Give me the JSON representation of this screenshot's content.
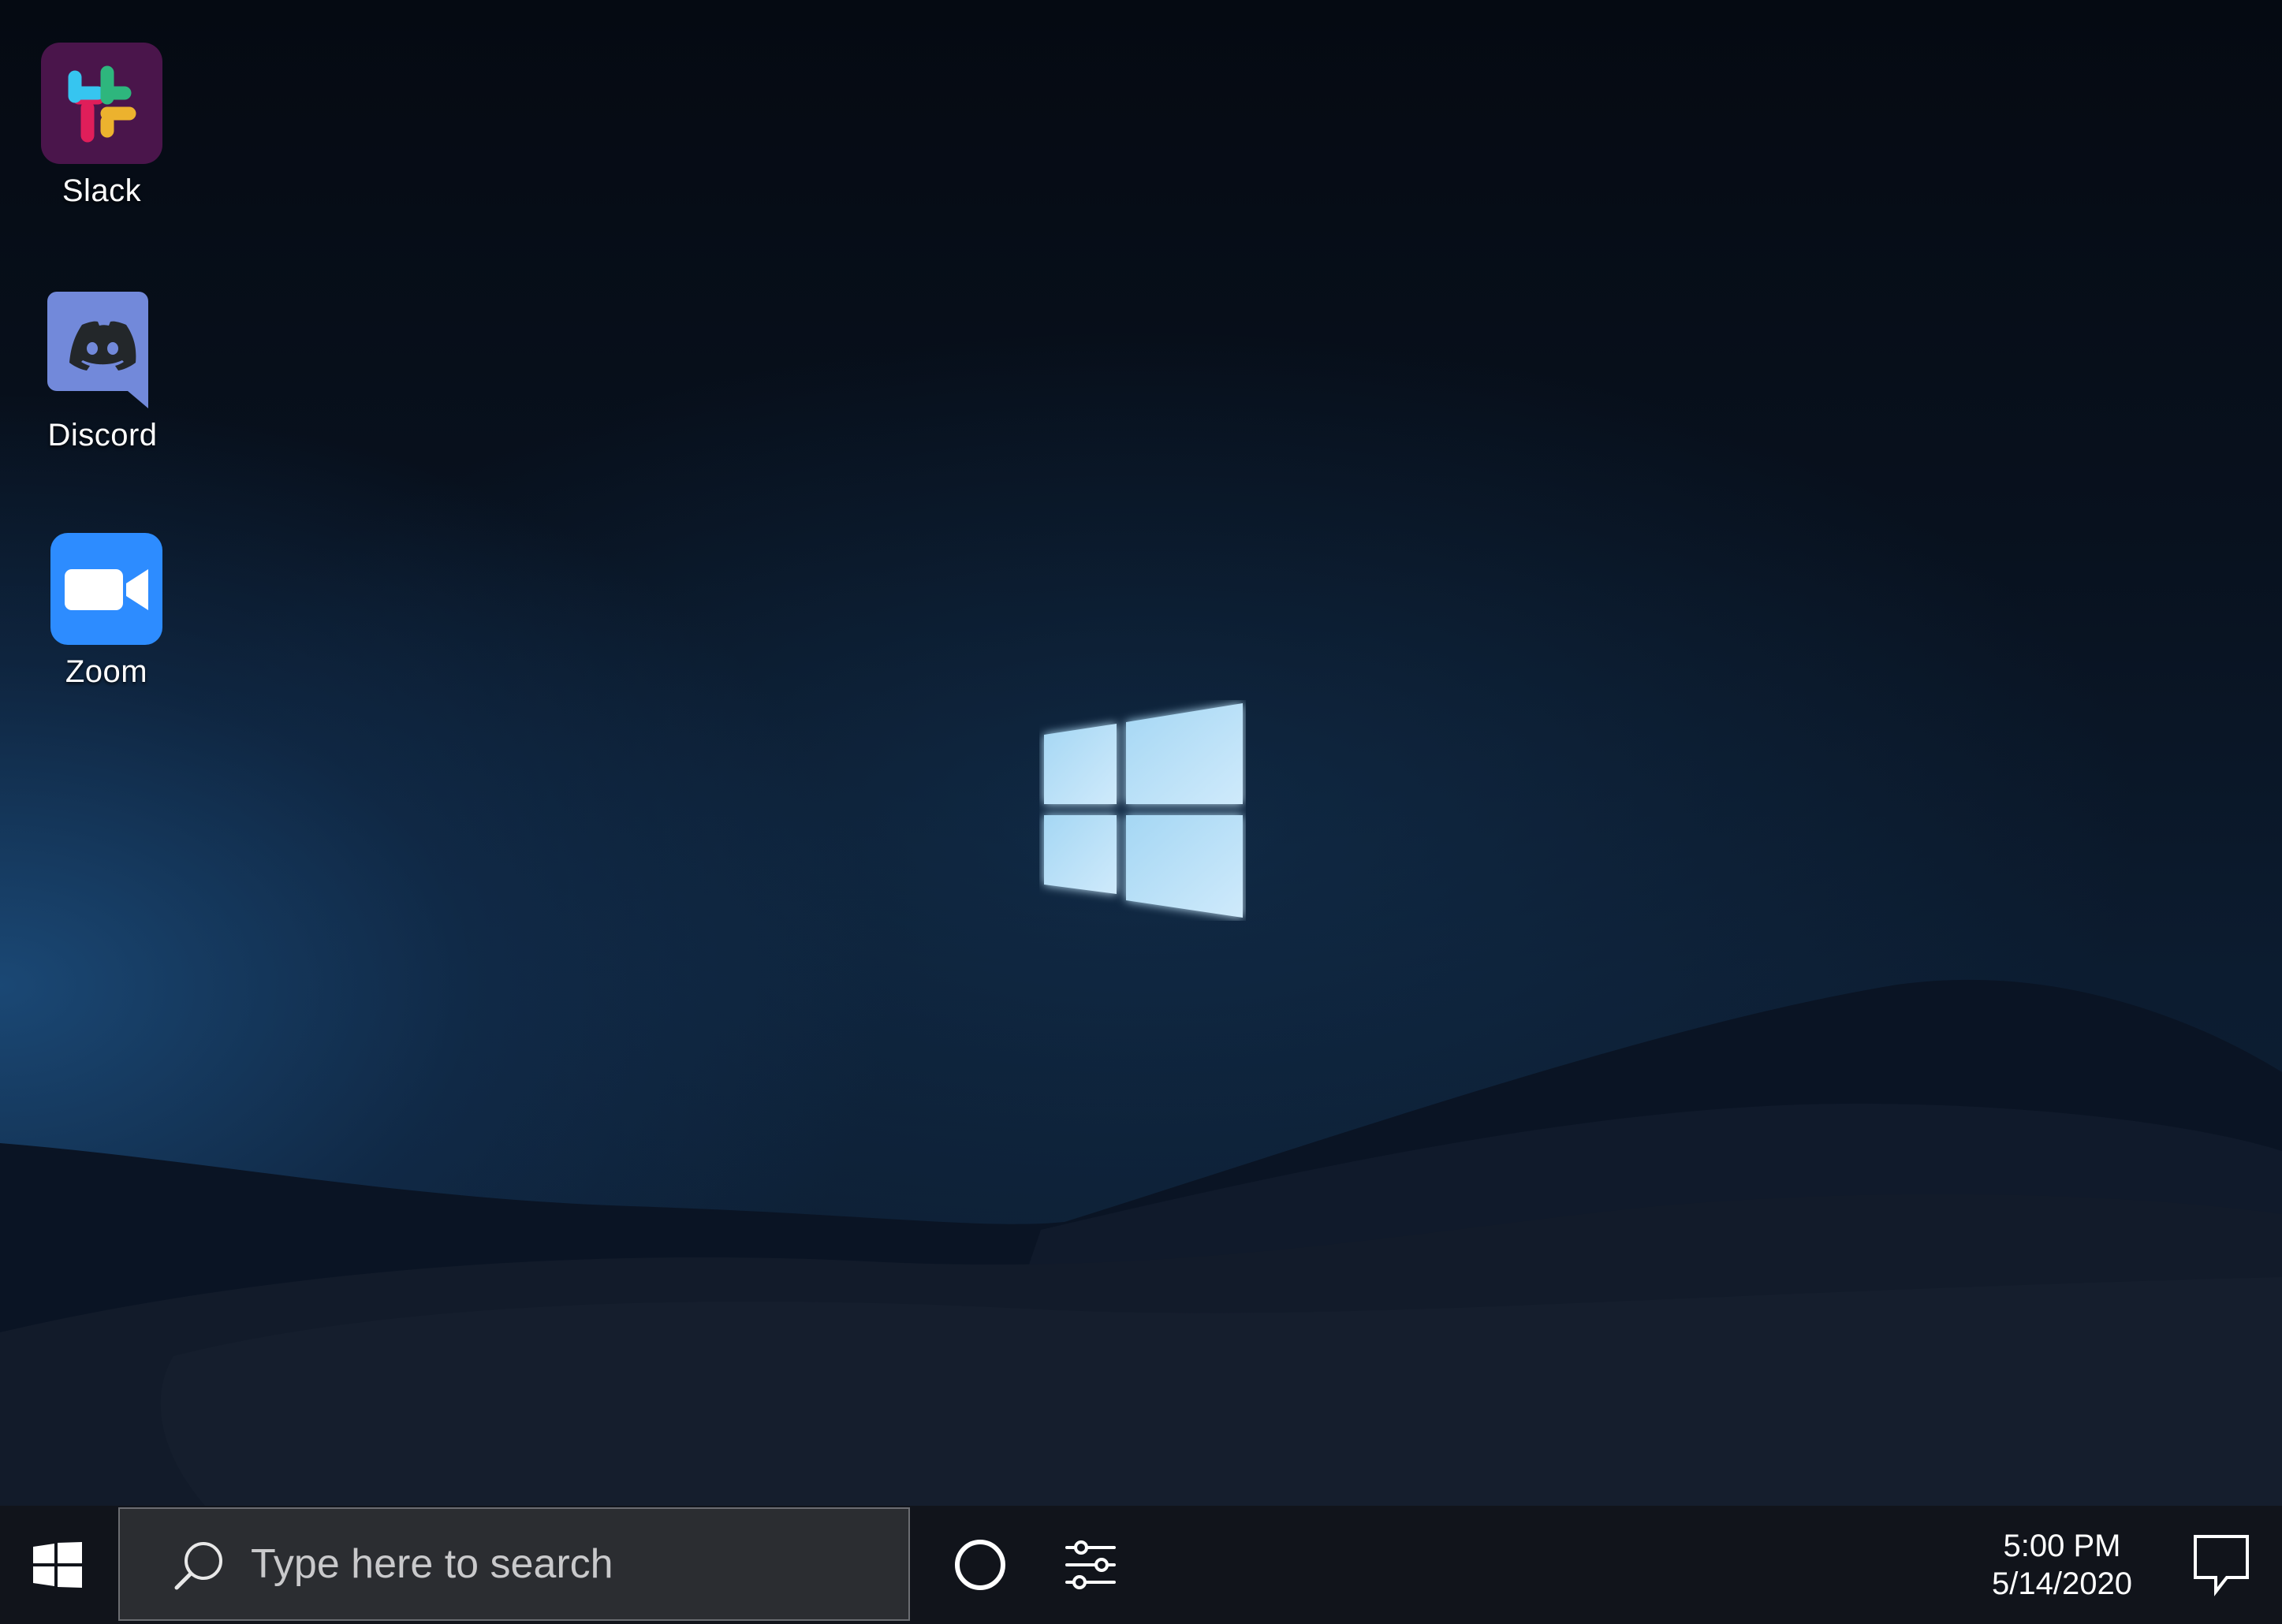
{
  "desktop": {
    "icons": [
      {
        "label": "Slack",
        "icon": "slack-icon"
      },
      {
        "label": "Discord",
        "icon": "discord-icon"
      },
      {
        "label": "Zoom",
        "icon": "zoom-icon"
      }
    ],
    "center_logo": "windows-logo"
  },
  "taskbar": {
    "start_icon": "windows-start-icon",
    "search": {
      "placeholder": "Type here to search",
      "icon": "search-icon"
    },
    "cortana_icon": "circle-icon",
    "settings_icon": "sliders-icon",
    "clock": {
      "time": "5:00 PM",
      "date": "5/14/2020"
    },
    "notification_icon": "speech-bubble-icon"
  },
  "colors": {
    "taskbar_bg": "#11141b",
    "search_bg": "#2b2d31",
    "slack_tile": "#4a154b",
    "discord_tile": "#7289da",
    "zoom_tile": "#2d8cff",
    "windows_logo": "#a9d8f5"
  }
}
